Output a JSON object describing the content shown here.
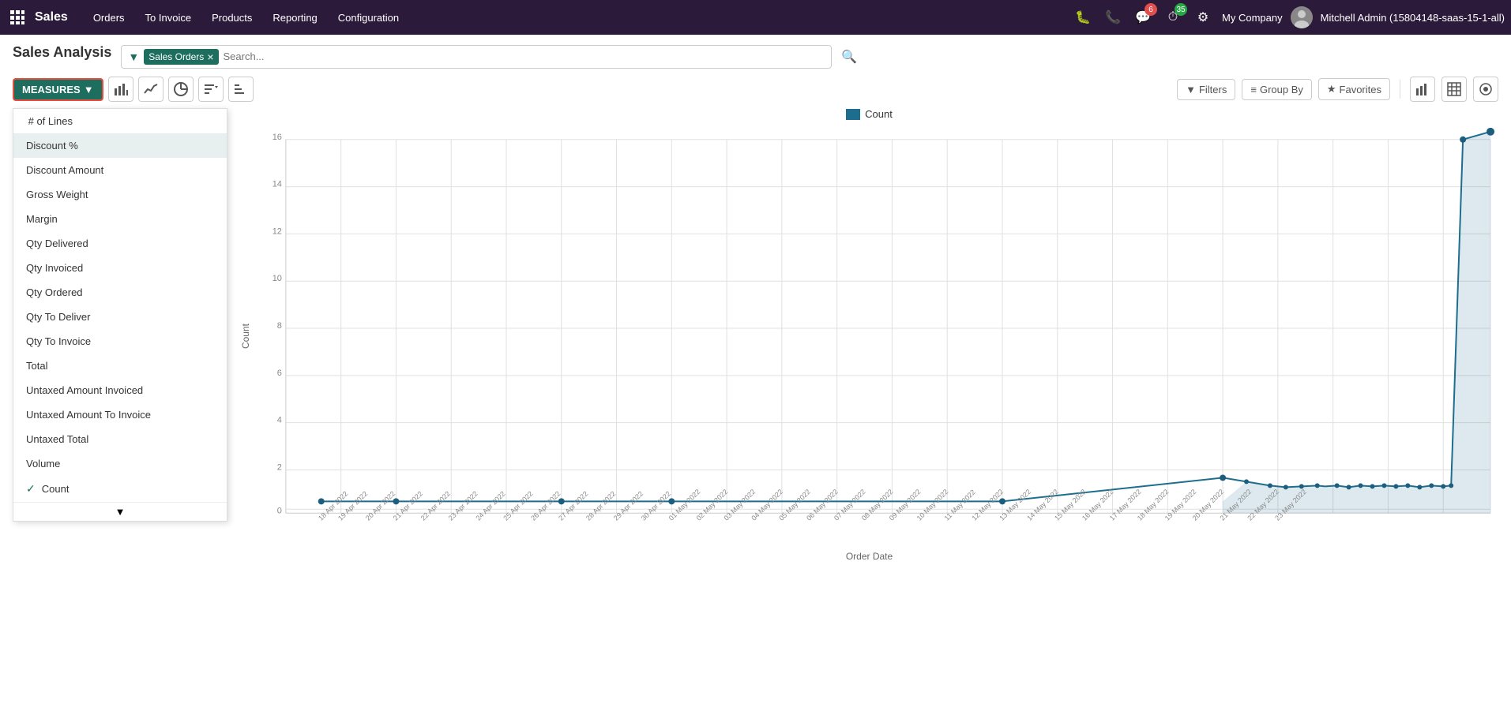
{
  "app": {
    "name": "Sales"
  },
  "nav": {
    "menu_items": [
      "Orders",
      "To Invoice",
      "Products",
      "Reporting",
      "Configuration"
    ],
    "notifications_count": "6",
    "timer_count": "35",
    "company": "My Company",
    "user": "Mitchell Admin (15804148-saas-15-1-all)"
  },
  "page": {
    "title": "Sales Analysis"
  },
  "search": {
    "filter_tag": "Sales Orders",
    "placeholder": "Search..."
  },
  "toolbar": {
    "measures_label": "MEASURES",
    "filters_label": "Filters",
    "group_by_label": "Group By",
    "favorites_label": "Favorites"
  },
  "measures_menu": {
    "items": [
      {
        "id": "lines",
        "label": "# of Lines",
        "selected": false
      },
      {
        "id": "discount_pct",
        "label": "Discount %",
        "selected": false
      },
      {
        "id": "discount_amount",
        "label": "Discount Amount",
        "selected": false
      },
      {
        "id": "gross_weight",
        "label": "Gross Weight",
        "selected": false
      },
      {
        "id": "margin",
        "label": "Margin",
        "selected": false
      },
      {
        "id": "qty_delivered",
        "label": "Qty Delivered",
        "selected": false
      },
      {
        "id": "qty_invoiced",
        "label": "Qty Invoiced",
        "selected": false
      },
      {
        "id": "qty_ordered",
        "label": "Qty Ordered",
        "selected": false
      },
      {
        "id": "qty_to_deliver",
        "label": "Qty To Deliver",
        "selected": false
      },
      {
        "id": "qty_to_invoice",
        "label": "Qty To Invoice",
        "selected": false
      },
      {
        "id": "total",
        "label": "Total",
        "selected": false
      },
      {
        "id": "untaxed_amount_invoiced",
        "label": "Untaxed Amount Invoiced",
        "selected": false
      },
      {
        "id": "untaxed_amount_to_invoice",
        "label": "Untaxed Amount To Invoice",
        "selected": false
      },
      {
        "id": "untaxed_total",
        "label": "Untaxed Total",
        "selected": false
      },
      {
        "id": "volume",
        "label": "Volume",
        "selected": false
      },
      {
        "id": "count",
        "label": "Count",
        "selected": true
      }
    ]
  },
  "chart": {
    "legend_label": "Count",
    "x_axis_label": "Order Date",
    "y_axis_label": "Count"
  }
}
